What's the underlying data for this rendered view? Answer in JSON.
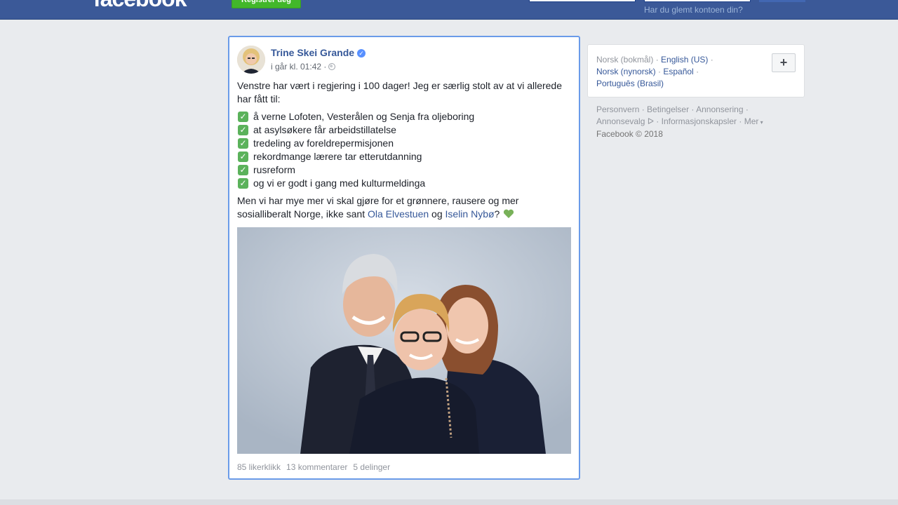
{
  "header": {
    "logo": "facebook",
    "register_label": "Registrer deg",
    "forgot_account": "Har du glemt kontoen din?"
  },
  "post": {
    "author": "Trine Skei Grande",
    "timestamp": "i går kl. 01:42 ·",
    "intro": "Venstre har vært i regjering i 100 dager! Jeg er særlig stolt av at vi allerede har fått til:",
    "checklist": [
      "å verne Lofoten, Vesterålen og Senja fra oljeboring",
      "at asylsøkere får arbeidstillatelse",
      "tredeling av foreldrepermisjonen",
      "rekordmange lærere tar etterutdanning",
      "rusreform",
      "og vi er godt i gang med kulturmeldinga"
    ],
    "outro_start": "Men vi har mye mer vi skal gjøre for et grønnere, rausere og mer sosialliberalt Norge, ikke sant ",
    "mention_1": "Ola Elvestuen",
    "outro_mid": " og ",
    "mention_2": "Iselin Nybø",
    "outro_end": "?",
    "likes": "85 likerklikk",
    "comments": "13 kommentarer",
    "shares": "5 delinger"
  },
  "languages": {
    "current": "Norsk (bokmål)",
    "options": [
      "English (US)",
      "Norsk (nynorsk)",
      "Español",
      "Português (Brasil)"
    ]
  },
  "footer": {
    "links": [
      "Personvern",
      "Betingelser",
      "Annonsering",
      "Annonsevalg",
      "Informasjonskapsler",
      "Mer"
    ],
    "copyright": "Facebook © 2018"
  },
  "colors": {
    "brand": "#3b5998",
    "link": "#365899",
    "highlight_border": "#6a9be9",
    "register_green": "#42b72a"
  }
}
